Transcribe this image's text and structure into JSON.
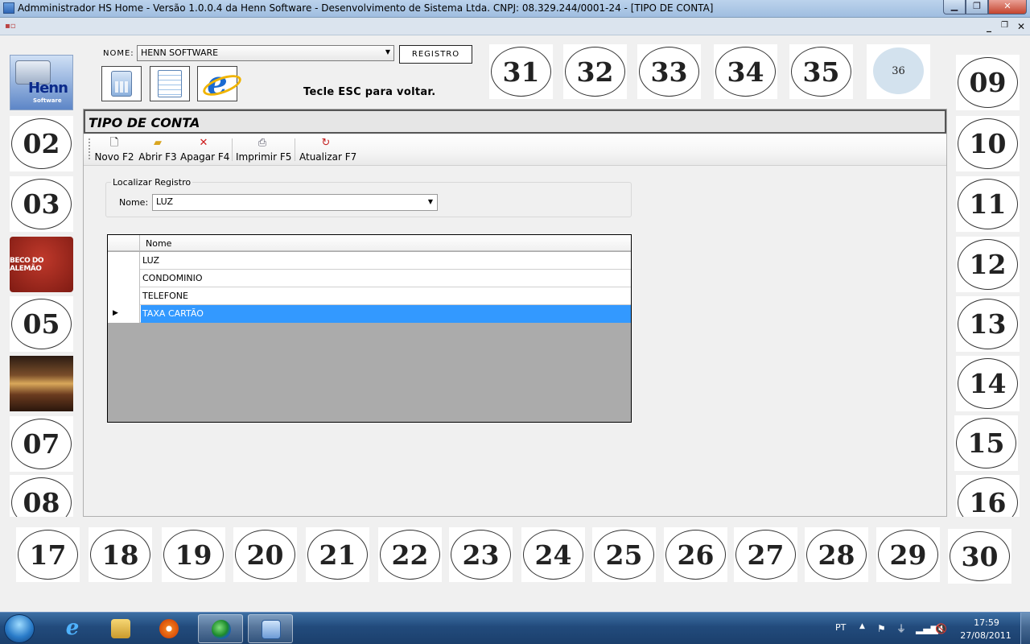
{
  "window": {
    "title": "Admministrador HS Home - Versão 1.0.0.4 da Henn Software - Desenvolvimento de Sistema Ltda. CNPJ: 08.329.244/0001-24 - [TIPO DE CONTA]",
    "minimize": "▁",
    "maximize": "❐",
    "close": "✕",
    "mdi_minimize": "_",
    "mdi_restore": "❐",
    "mdi_close": "✕"
  },
  "top": {
    "nome_label": "NOME:",
    "nome_value": "HENN SOFTWARE",
    "registro_label": "REGISTRO",
    "hint": "Tecle ESC para voltar."
  },
  "logos": {
    "henn_text": "Henn",
    "henn_sub": "Software",
    "beco": "BECO DO ALEMÃO"
  },
  "tiles": {
    "top": [
      "31",
      "32",
      "33",
      "34",
      "35",
      "36"
    ],
    "left": [
      "02",
      "03",
      "05",
      "07",
      "08"
    ],
    "right": [
      "09",
      "10",
      "11",
      "12",
      "13",
      "14",
      "15",
      "16"
    ],
    "bottom": [
      "17",
      "18",
      "19",
      "20",
      "21",
      "22",
      "23",
      "24",
      "25",
      "26",
      "27",
      "28",
      "29",
      "30"
    ]
  },
  "form": {
    "title": "TIPO DE CONTA",
    "toolbar": {
      "novo": "Novo F2",
      "abrir": "Abrir F3",
      "apagar": "Apagar F4",
      "imprimir": "Imprimir F5",
      "atualizar": "Atualizar F7"
    },
    "localizar": {
      "group_title": "Localizar Registro",
      "nome_label": "Nome:",
      "nome_value": "LUZ"
    },
    "grid": {
      "column": "Nome",
      "rows": [
        "LUZ",
        "CONDOMINIO",
        "TELEFONE",
        "TAXA CARTÃO"
      ],
      "selected_index": 3,
      "selection_color": "#3399ff"
    }
  },
  "taskbar": {
    "language": "PT",
    "time": "17:59",
    "date": "27/08/2011"
  }
}
